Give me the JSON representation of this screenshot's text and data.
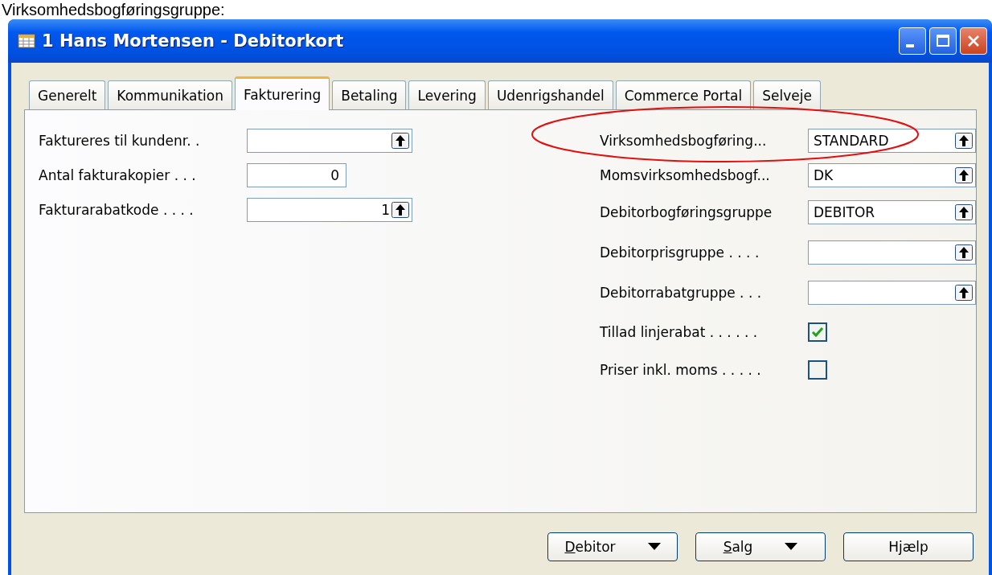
{
  "caption_above": "Virksomhedsbogføringsgruppe:",
  "window": {
    "title": "1 Hans Mortensen - Debitorkort"
  },
  "tabs": [
    {
      "label": "Generelt",
      "selected": false
    },
    {
      "label": "Kommunikation",
      "selected": false
    },
    {
      "label": "Fakturering",
      "selected": true
    },
    {
      "label": "Betaling",
      "selected": false
    },
    {
      "label": "Levering",
      "selected": false
    },
    {
      "label": "Udenrigshandel",
      "selected": false
    },
    {
      "label": "Commerce Portal",
      "selected": false
    },
    {
      "label": "Selveje",
      "selected": false
    }
  ],
  "left_fields": [
    {
      "kind": "lookup",
      "label": "Faktureres til kundenr. ."
    },
    {
      "kind": "number",
      "label": "Antal fakturakopier . . .",
      "value": "0"
    },
    {
      "kind": "lookup",
      "label": "Fakturarabatkode . . . .",
      "value": "1"
    }
  ],
  "right_fields": [
    {
      "kind": "lookup",
      "label": "Virksomhedsbogføring...",
      "value": "STANDARD",
      "circled": true
    },
    {
      "kind": "lookup",
      "label": "Momsvirksomhedsbogf...",
      "value": "DK",
      "circled": false
    },
    {
      "kind": "lookup",
      "label": "Debitorbogføringsgruppe",
      "value": "DEBITOR",
      "circled": false
    },
    {
      "kind": "lookup",
      "label": "Debitorprisgruppe . . . .",
      "circled": false
    },
    {
      "kind": "lookup",
      "label": "Debitorrabatgruppe . . .",
      "circled": false
    },
    {
      "kind": "checkbox",
      "label": "Tillad linjerabat . . . . . .",
      "checked": true,
      "circled": false
    },
    {
      "kind": "checkbox",
      "label": "Priser inkl. moms . . . . .",
      "checked": false,
      "circled": false
    }
  ],
  "buttons": [
    {
      "label": "Debitor",
      "menu": true,
      "mnemonic": true
    },
    {
      "label": "Salg",
      "menu": true,
      "mnemonic": true
    },
    {
      "label": "Hjælp",
      "menu": false,
      "mnemonic": false
    }
  ]
}
